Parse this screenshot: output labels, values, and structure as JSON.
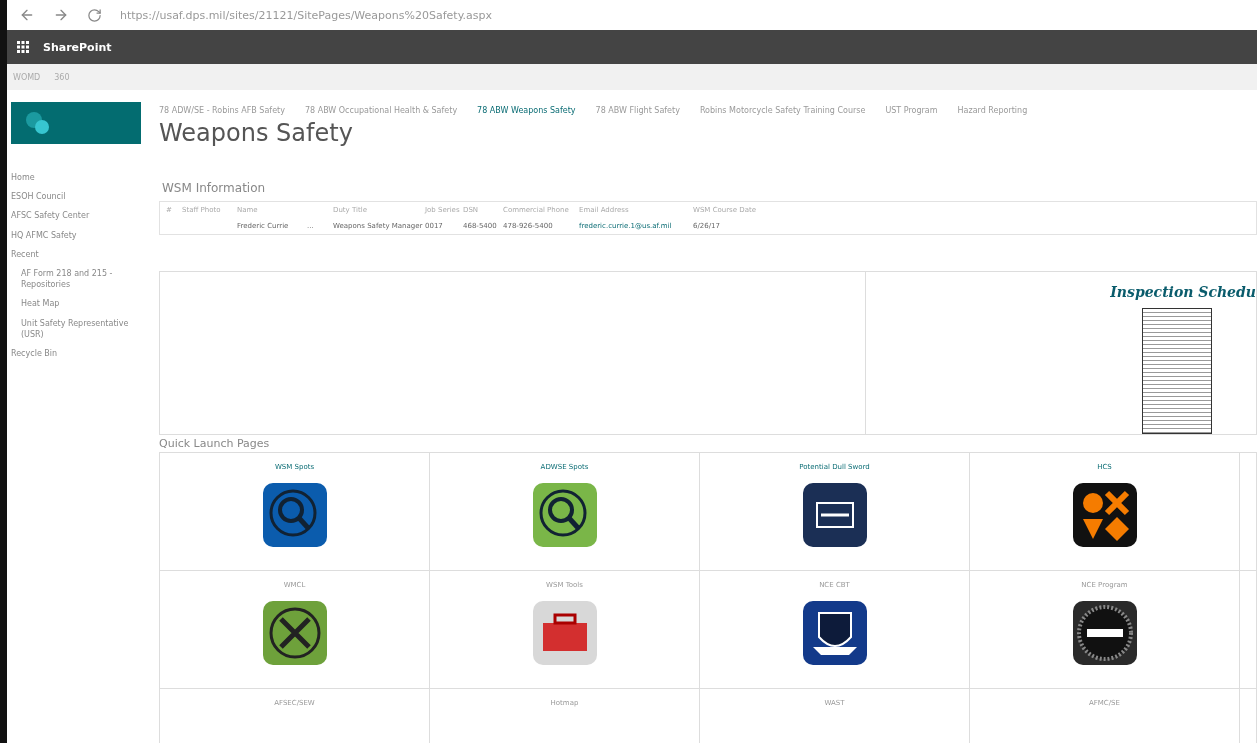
{
  "browser": {
    "url": "https://usaf.dps.mil/sites/21121/SitePages/Weapons%20Safety.aspx"
  },
  "suite_bar": {
    "title": "SharePoint"
  },
  "breadcrumb": [
    "WOMD",
    "360"
  ],
  "top_nav": [
    {
      "label": "78 ADW/SE - Robins AFB Safety",
      "selected": false
    },
    {
      "label": "78 ABW Occupational Health & Safety",
      "selected": false
    },
    {
      "label": "78 ABW Weapons Safety",
      "selected": true
    },
    {
      "label": "78 ABW Flight Safety",
      "selected": false
    },
    {
      "label": "Robins Motorcycle Safety Training Course",
      "selected": false
    },
    {
      "label": "UST Program",
      "selected": false
    },
    {
      "label": "Hazard Reporting",
      "selected": false
    }
  ],
  "page_title": "Weapons Safety",
  "sidebar": {
    "items": [
      {
        "label": "Home"
      },
      {
        "label": "ESOH Council"
      },
      {
        "label": "AFSC Safety Center"
      },
      {
        "label": "HQ AFMC Safety"
      },
      {
        "label": "Recent",
        "children": [
          {
            "label": "AF Form 218 and 215 - Repositories"
          },
          {
            "label": "Heat Map"
          },
          {
            "label": "Unit Safety Representative (USR)"
          }
        ]
      },
      {
        "label": "Recycle Bin"
      }
    ]
  },
  "wsm_section": {
    "title": "WSM Information",
    "columns": [
      "#",
      "Staff Photo",
      "Name",
      "Duty Title",
      "Job Series",
      "DSN",
      "Commercial Phone",
      "Email Address",
      "WSM Course Date"
    ],
    "rows": [
      {
        "name": "Frederic Currie",
        "more": "...",
        "duty_title": "Weapons Safety Manager",
        "job_series": "0017",
        "dsn": "468-5400",
        "phone": "478-926-5400",
        "email": "frederic.currie.1@us.af.mil",
        "course_date": "6/26/17"
      }
    ]
  },
  "inspection_panel": {
    "title": "Inspection Schedu"
  },
  "quick_launch": {
    "title": "Quick Launch Pages",
    "tiles": [
      {
        "label": "WSM Spots",
        "kind": "magnifier-blue"
      },
      {
        "label": "ADWSE Spots",
        "kind": "magnifier-green"
      },
      {
        "label": "Potential Dull Sword",
        "kind": "dullsword"
      },
      {
        "label": "HCS",
        "kind": "hazard"
      },
      {
        "label": "WMCL",
        "kind": "tools"
      },
      {
        "label": "WSM Tools",
        "kind": "toolbox"
      },
      {
        "label": "NCE CBT",
        "kind": "shield"
      },
      {
        "label": "NCE Program",
        "kind": "seal"
      },
      {
        "label": "AFSEC/SEW",
        "kind": "none"
      },
      {
        "label": "Hotmap",
        "kind": "none"
      },
      {
        "label": "WAST",
        "kind": "none"
      },
      {
        "label": "AFMC/SE",
        "kind": "none"
      }
    ]
  }
}
